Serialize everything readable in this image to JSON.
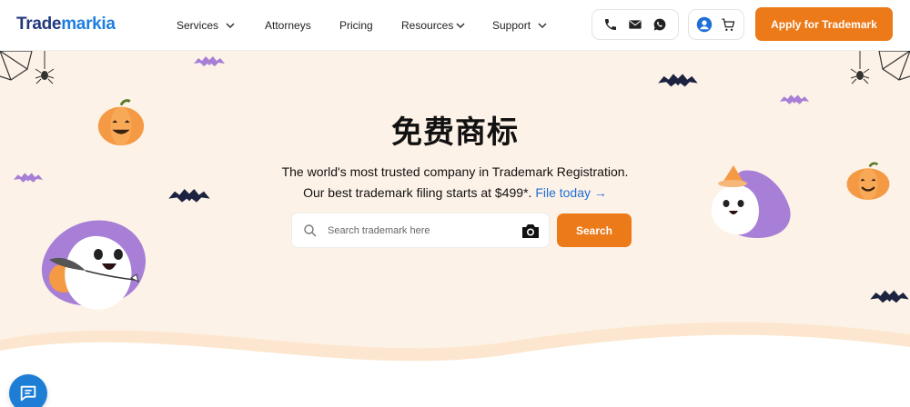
{
  "brand": {
    "logo_part1": "Trade",
    "logo_part2": "markia"
  },
  "nav": {
    "services": "Services",
    "attorneys": "Attorneys",
    "pricing": "Pricing",
    "resources": "Resources",
    "support": "Support"
  },
  "header_icons": [
    "phone-icon",
    "mail-icon",
    "whatsapp-icon",
    "user-icon",
    "cart-icon"
  ],
  "apply_label": "Apply for Trademark",
  "hero": {
    "title": "免费商标",
    "subtitle_line1": "The world's most trusted company in Trademark Registration.",
    "subtitle_line2": "Our best trademark filing starts at $499*.",
    "file_link": "File today →"
  },
  "search": {
    "placeholder": "Search trademark here",
    "value": "",
    "button_label": "Search"
  },
  "colors": {
    "accent": "#ec7a19",
    "brand_dark": "#23387e",
    "brand_blue": "#1f7fe0",
    "link": "#1f6fd6",
    "hero_bg": "#fdf2e7",
    "purple": "#a77fd6"
  }
}
